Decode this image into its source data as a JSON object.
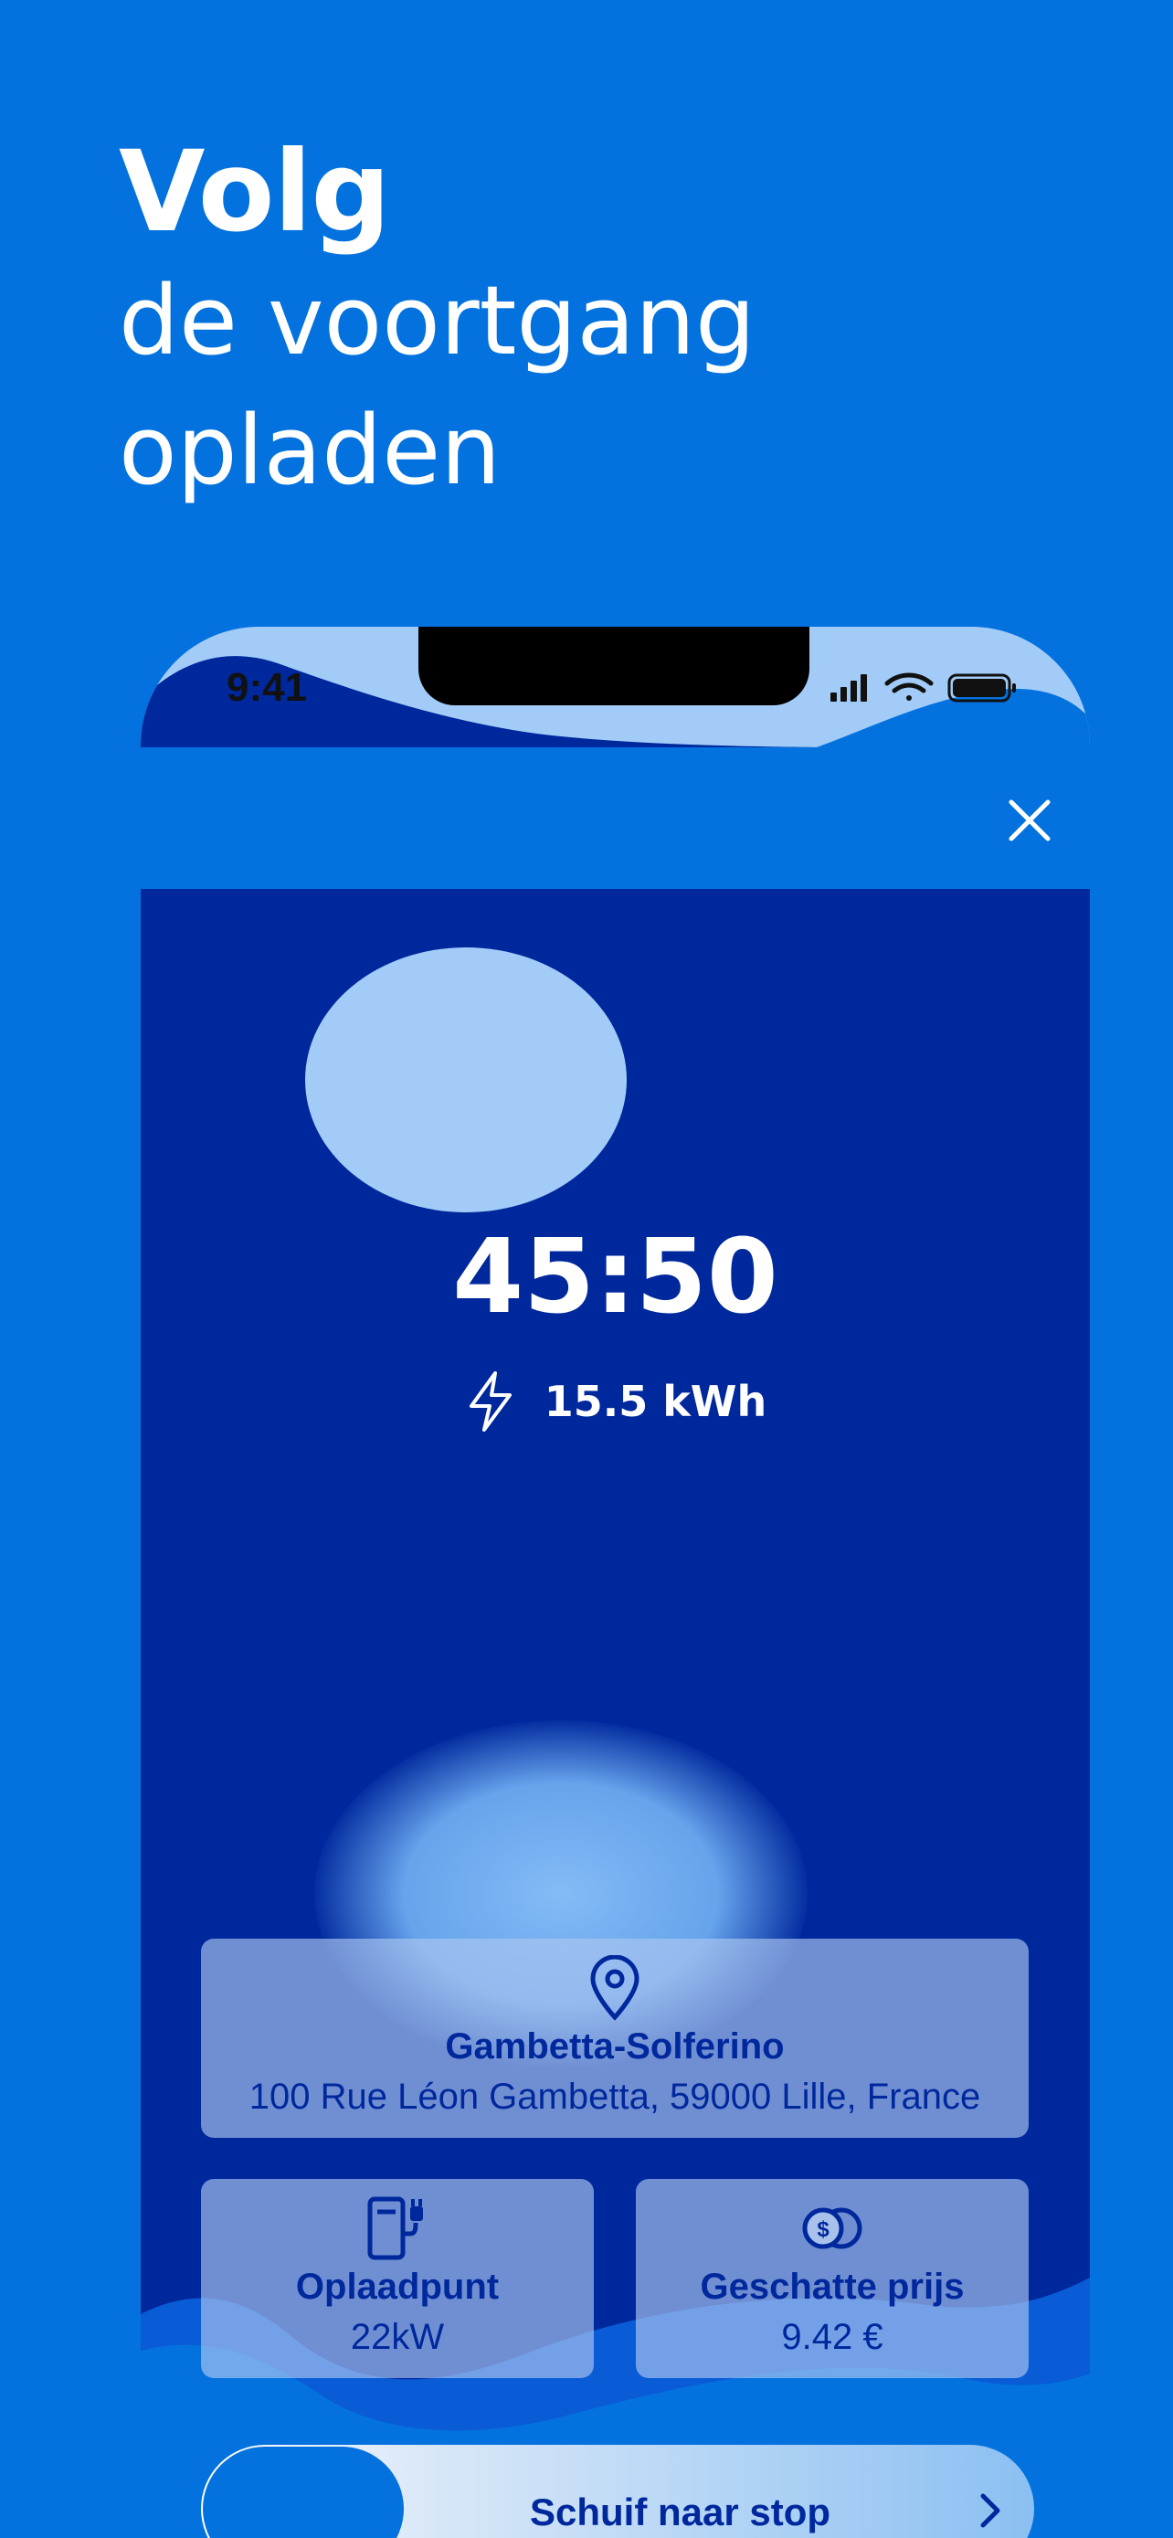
{
  "headline": {
    "bold": "Volg",
    "line2": "de voortgang",
    "line3": "opladen"
  },
  "status_bar": {
    "time": "9:41"
  },
  "session": {
    "duration": "45:50",
    "energy": "15.5 kWh"
  },
  "location": {
    "name": "Gambetta-Solferino",
    "address": "100 Rue Léon Gambetta, 59000 Lille, France"
  },
  "charge_point": {
    "title": "Oplaadpunt",
    "power": "22kW"
  },
  "price": {
    "title": "Geschatte prijs",
    "value": "9.42 €"
  },
  "slider": {
    "label": "Schuif naar stop"
  },
  "colors": {
    "background": "#0372DE",
    "panel": "#00289D",
    "accent_light": "#A2CCF7",
    "text_dark": "#00289D"
  },
  "icons": [
    "close-icon",
    "bolt-icon",
    "location-pin-icon",
    "charger-icon",
    "coins-icon",
    "chevron-right-icon",
    "signal-icon",
    "wifi-icon",
    "battery-icon"
  ]
}
